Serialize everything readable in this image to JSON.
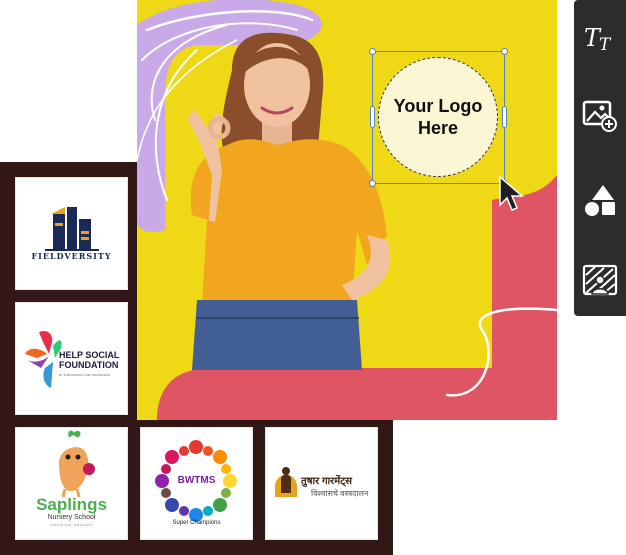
{
  "canvas": {
    "placeholder_line1": "Your Logo",
    "placeholder_line2": "Here"
  },
  "toolbar": {
    "tools": [
      {
        "name": "text-tool",
        "icon": "text-icon"
      },
      {
        "name": "add-image-tool",
        "icon": "image-add-icon"
      },
      {
        "name": "shapes-tool",
        "icon": "shapes-icon"
      },
      {
        "name": "background-tool",
        "icon": "background-pattern-icon"
      }
    ]
  },
  "logos": [
    {
      "name": "fieldversity",
      "text": "FIELDVERSITY"
    },
    {
      "name": "help-social-foundation",
      "line1": "HELP SOCIAL",
      "line2": "FOUNDATION",
      "tagline": "BY THE PEOPLE, FOR THE PEOPLE"
    },
    {
      "name": "saplings",
      "title": "Saplings",
      "subtitle": "Nursery School",
      "tagline": "GROWING DREAMS"
    },
    {
      "name": "bwtms",
      "title": "BWTMS",
      "subtitle": "Super Champions"
    },
    {
      "name": "tushar-garments",
      "line1": "तुषार गारमेंट्स",
      "line2": "विश्वासचे वस्त्रदालन"
    }
  ],
  "colors": {
    "canvas_yellow": "#efd916",
    "accent_purple": "#c9a9e8",
    "accent_red": "#e05563",
    "panel_dark": "#321717",
    "toolbar_dark": "#2c2c2c",
    "selection_blue": "#4a86c8"
  }
}
